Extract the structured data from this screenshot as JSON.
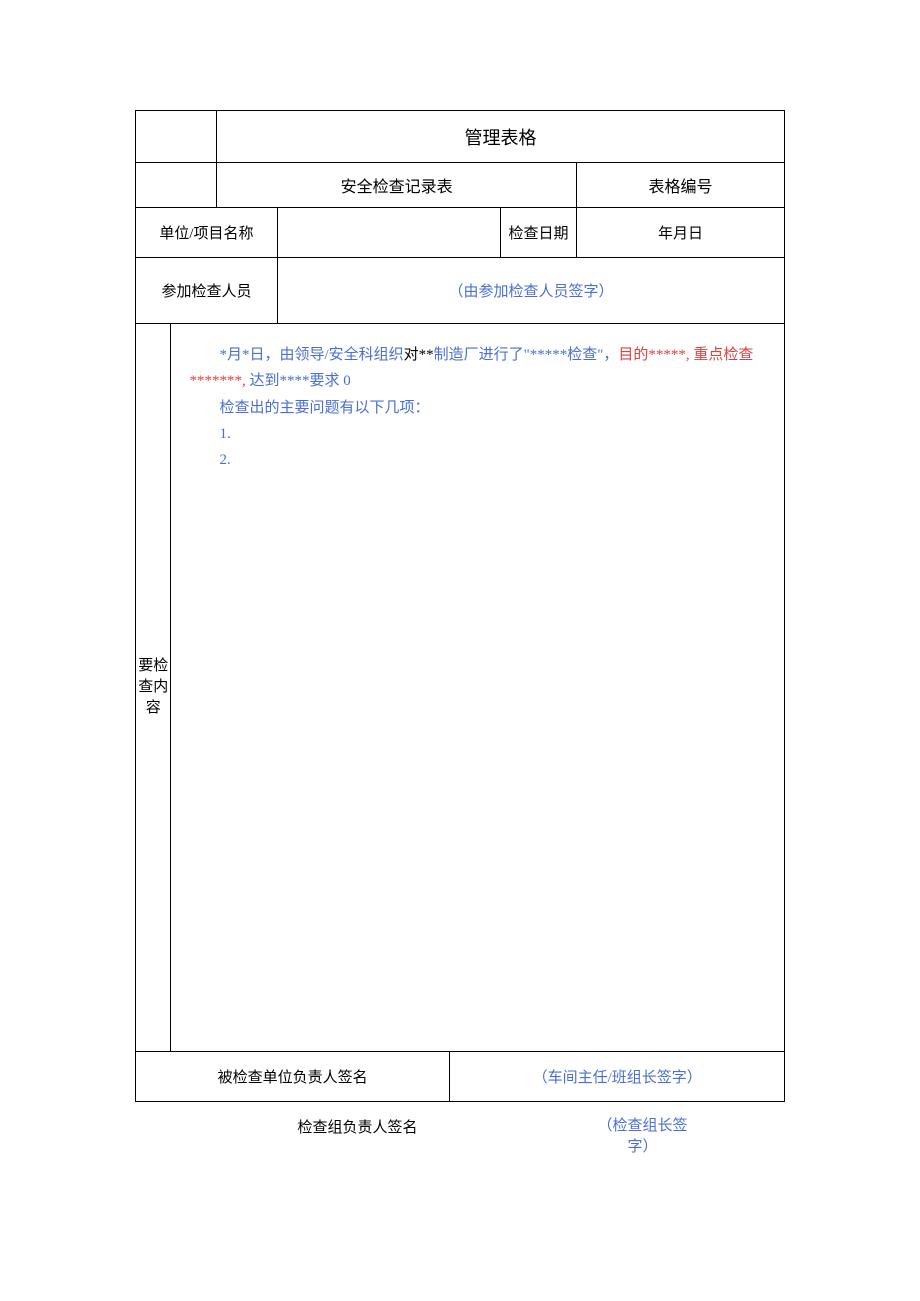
{
  "header": {
    "title": "管理表格",
    "subtitle": "安全检查记录表",
    "formNumberLabel": "表格编号"
  },
  "row1": {
    "label": "单位/项目名称",
    "value": "",
    "dateLabel": "检查日期",
    "dateValue": "年月日"
  },
  "row2": {
    "label": "参加检查人员",
    "value": "（由参加检查人员签字）"
  },
  "content": {
    "sideLabel": "要检查内容",
    "segments": [
      {
        "text": "*月*日，由领导/安全科组织",
        "cls": "blue"
      },
      {
        "text": "对**",
        "cls": "black"
      },
      {
        "text": "制造厂进行了\"*****检查\"，",
        "cls": "blue"
      },
      {
        "text": "目的*****, 重点检查*******, ",
        "cls": "red"
      },
      {
        "text": "达到****要求 0",
        "cls": "blue"
      }
    ],
    "line2": "检查出的主要问题有以下几项：",
    "line3": "1.",
    "line4": "2."
  },
  "sign": {
    "label": "被检查单位负责人签名",
    "value": "（车间主任/班组长签字）"
  },
  "bottom": {
    "label": "检查组负责人签名",
    "value": "（检查组长签字）"
  }
}
